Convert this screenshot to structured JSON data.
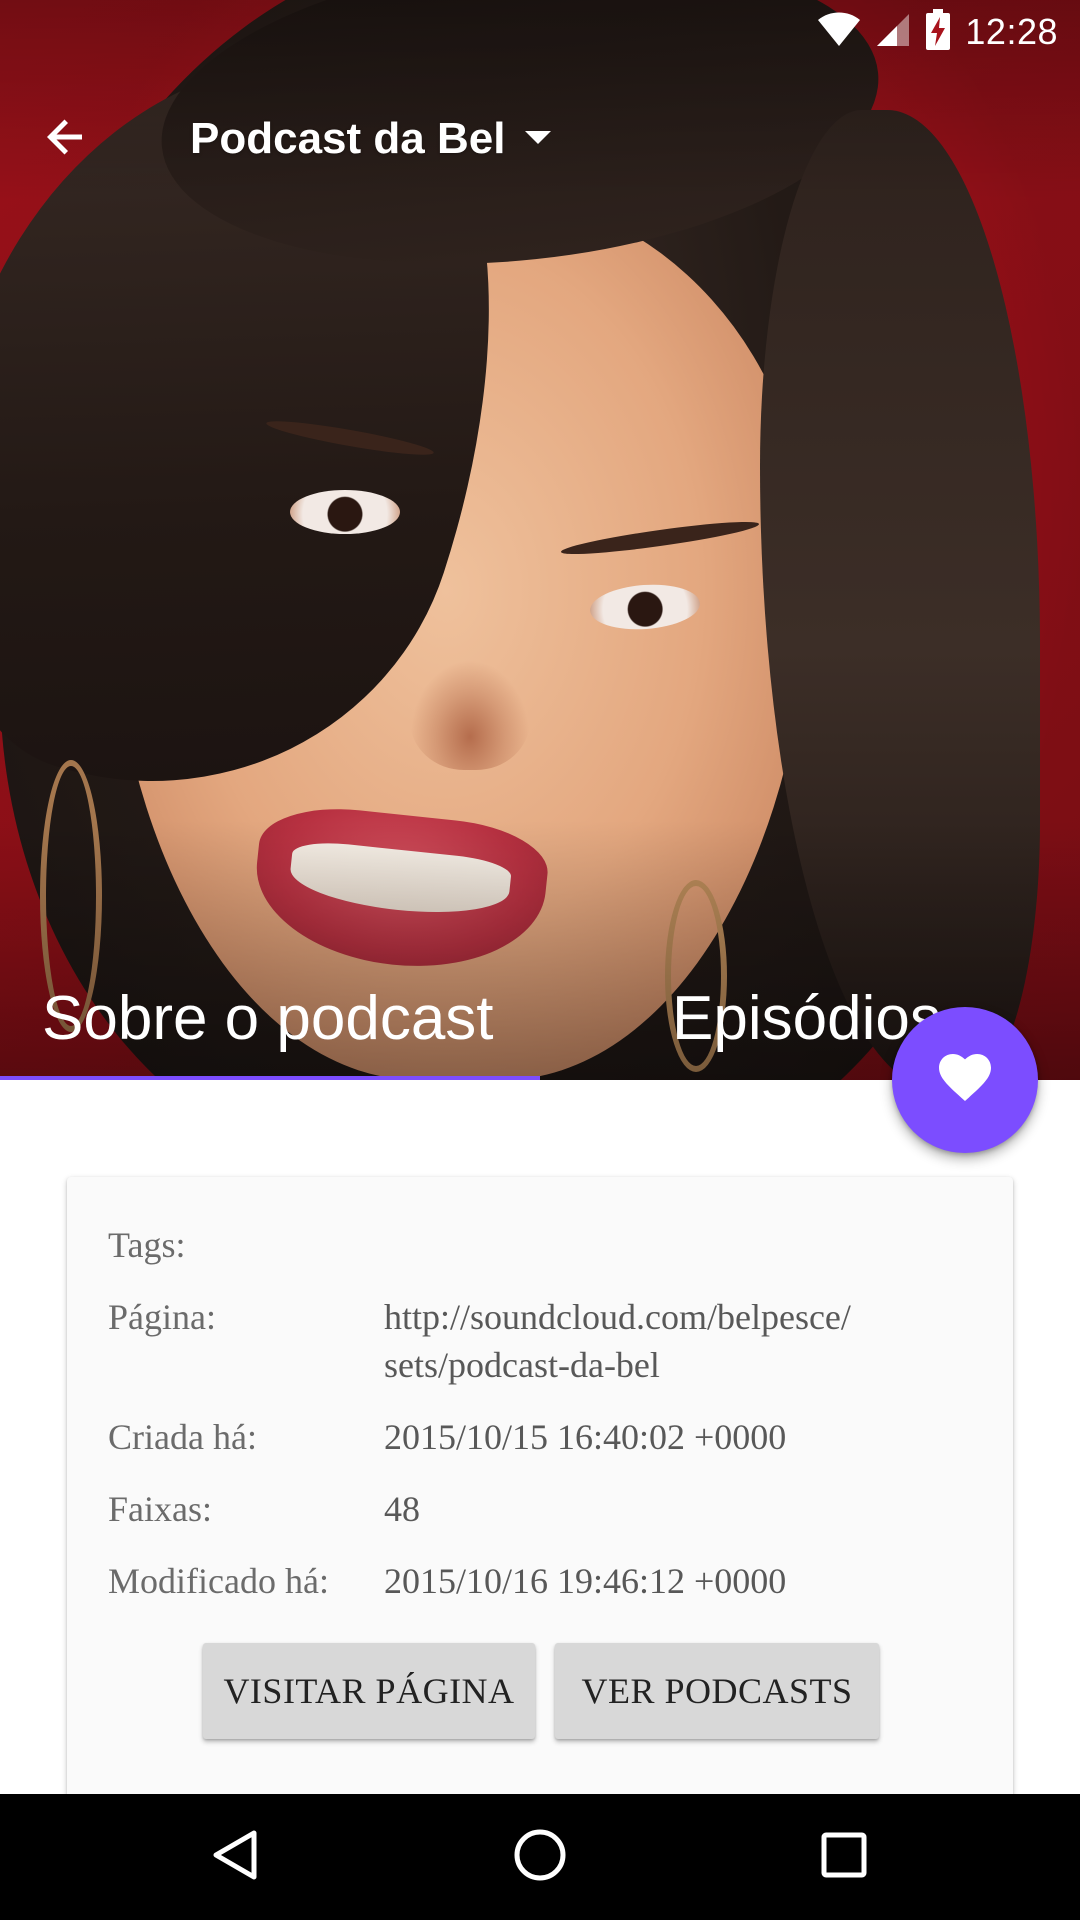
{
  "status_bar": {
    "time": "12:28",
    "icons": [
      "wifi-icon",
      "cell-signal-icon",
      "battery-charging-icon"
    ]
  },
  "toolbar": {
    "title": "Podcast da Bel",
    "back_icon": "arrow-back-icon",
    "dropdown_icon": "dropdown-arrow-icon"
  },
  "tabs": [
    {
      "label": "Sobre o podcast",
      "selected": true
    },
    {
      "label": "Episódios",
      "selected": false
    }
  ],
  "fab": {
    "icon": "heart-icon"
  },
  "details": [
    {
      "label": "Tags:",
      "value": ""
    },
    {
      "label": "Página:",
      "value": "http://soundcloud.com/belpesce/sets/podcast-da-bel"
    },
    {
      "label": "Criada há:",
      "value": "2015/10/15 16:40:02 +0000"
    },
    {
      "label": "Faixas:",
      "value": "48"
    },
    {
      "label": "Modificado há:",
      "value": "2015/10/16 19:46:12 +0000"
    }
  ],
  "buttons": {
    "visit_page": "VISITAR PÁGINA",
    "view_podcasts": "VER PODCASTS"
  },
  "colors": {
    "accent": "#7c4dff",
    "hero_background": "#a8131c",
    "navbar": "#000000"
  },
  "navbar": {
    "icons": [
      "nav-back-icon",
      "nav-home-icon",
      "nav-recents-icon"
    ]
  }
}
